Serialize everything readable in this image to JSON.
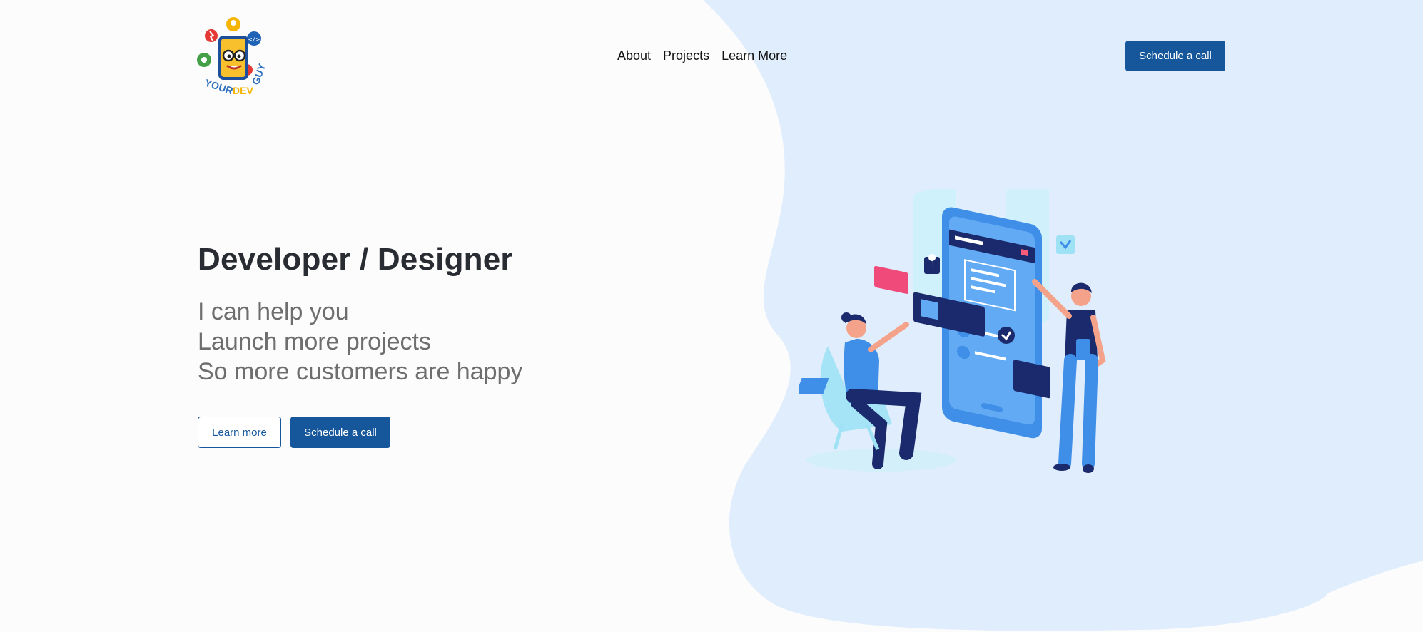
{
  "logo": {
    "alt": "YOUR DEV GUY logo",
    "text_parts": [
      "YOUR",
      "DEV",
      "GUY"
    ]
  },
  "nav": {
    "items": [
      "About",
      "Projects",
      "Learn More"
    ]
  },
  "header": {
    "cta_label": "Schedule a call"
  },
  "hero": {
    "title": "Developer / Designer",
    "subtitle_lines": [
      "I can help you",
      "Launch more projects",
      "So more customers are happy"
    ],
    "learn_more_label": "Learn more",
    "schedule_label": "Schedule a call"
  },
  "colors": {
    "accent": "#16569b",
    "blob": "#e0edfc",
    "title": "#292d33",
    "subtitle": "#6e6e6e"
  },
  "illustration": {
    "name": "people-building-mobile-app-illustration"
  }
}
